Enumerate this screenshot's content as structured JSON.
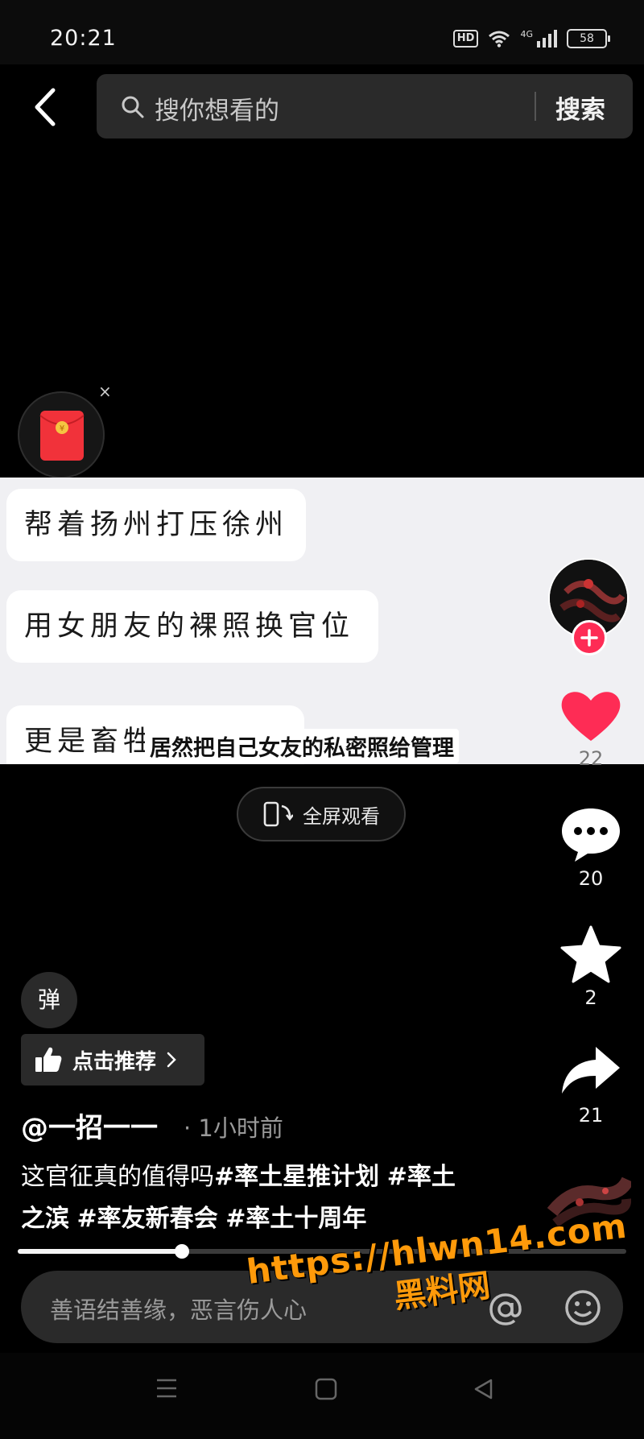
{
  "status_bar": {
    "time": "20:21",
    "hd_badge": "HD",
    "network": "4G",
    "battery": "58"
  },
  "search": {
    "placeholder": "搜你想看的",
    "button_label": "搜索"
  },
  "red_packet": {
    "close_symbol": "×"
  },
  "video": {
    "chat_lines": [
      "帮着扬州打压徐州",
      "用女朋友的裸照换官位",
      "更是畜牲"
    ],
    "subtitle": "居然把自己女友的私密照给管理"
  },
  "fullscreen": {
    "label": "全屏观看"
  },
  "actions": {
    "likes": "22",
    "comments": "20",
    "favorites": "2",
    "shares": "21"
  },
  "danmaku": {
    "label": "弹"
  },
  "recommend": {
    "label": "点击推荐"
  },
  "post": {
    "author": "@一招一一",
    "time": "· 1小时前",
    "caption_text": "这官征真的值得吗",
    "hashtags": [
      "#率土星推计划",
      "#率土之滨",
      "#率友新春会",
      "#率土十周年"
    ]
  },
  "progress": {
    "fraction": 0.27
  },
  "comment": {
    "placeholder": "善语结善缘，恶言伤人心"
  },
  "watermark": {
    "url": "https://hlwn14.com",
    "name": "黑料网"
  },
  "colors": {
    "accent": "#fe2c55",
    "watermark": "#ff9a0a",
    "search_bg": "#2a2a2a"
  }
}
